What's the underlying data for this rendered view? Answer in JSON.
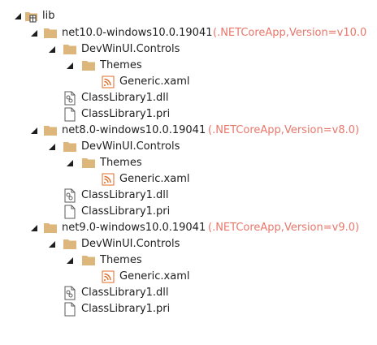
{
  "colors": {
    "folder": "#dcb67a",
    "arrow": "#1e1e1e",
    "text": "#1e1e1e",
    "target_framework": "#e8776b",
    "xaml_icon": "#e06c29",
    "file_outline": "#5a5a5a"
  },
  "tree": {
    "root": {
      "label": "lib",
      "icon": "package-folder-icon"
    },
    "frameworks": [
      {
        "label": "net10.0-windows10.0.19041",
        "target": "(.NETCoreApp,Version=v10.0",
        "namespace_folder": "DevWinUI.Controls",
        "themes_folder": "Themes",
        "xaml_file": "Generic.xaml",
        "dll_file": "ClassLibrary1.dll",
        "pri_file": "ClassLibrary1.pri"
      },
      {
        "label": "net8.0-windows10.0.19041",
        "target": "(.NETCoreApp,Version=v8.0)",
        "namespace_folder": "DevWinUI.Controls",
        "themes_folder": "Themes",
        "xaml_file": "Generic.xaml",
        "dll_file": "ClassLibrary1.dll",
        "pri_file": "ClassLibrary1.pri"
      },
      {
        "label": "net9.0-windows10.0.19041",
        "target": "(.NETCoreApp,Version=v9.0)",
        "namespace_folder": "DevWinUI.Controls",
        "themes_folder": "Themes",
        "xaml_file": "Generic.xaml",
        "dll_file": "ClassLibrary1.dll",
        "pri_file": "ClassLibrary1.pri"
      }
    ]
  }
}
